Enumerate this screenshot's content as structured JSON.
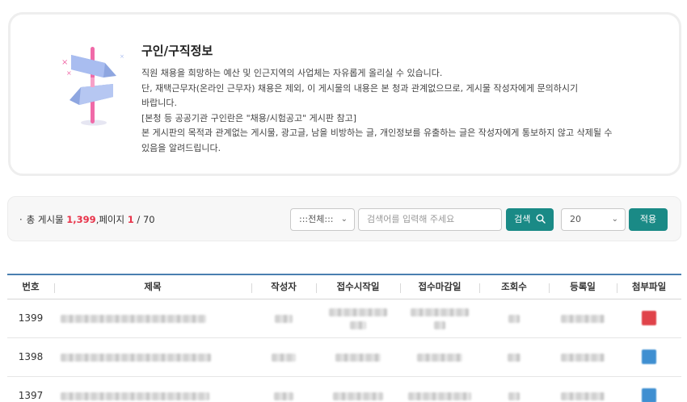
{
  "info": {
    "title": "구인/구직정보",
    "lines": [
      "직원 채용을 희망하는 예산 및 인근지역의 사업체는 자유롭게 올리실 수 있습니다.",
      "단, 재택근무자(온라인 근무자) 채용은 제외, 이 게시물의 내용은 본 청과 관계없으므로, 게시물 작성자에게 문의하시기",
      "바랍니다.",
      "[본청 등 공공기관 구인란은 \"채용/시험공고\" 게시판 참고]",
      "본 게시판의 목적과 관계없는 게시물, 광고글, 남을 비방하는 글, 개인정보를 유출하는 글은 작성자에게 통보하지 않고 삭제될 수",
      "있음을 알려드립니다."
    ]
  },
  "summary": {
    "bullet": "·",
    "total_label": "총 게시물",
    "total_value": "1,399",
    "separator": ",",
    "page_label": "페이지",
    "current_page": "1",
    "page_total": "/ 70"
  },
  "search": {
    "field_select": ":::전체:::",
    "input_placeholder": "검색어를 입력해 주세요",
    "search_button": "검색",
    "page_size": "20",
    "apply_button": "적용"
  },
  "table": {
    "headers": [
      "번호",
      "제목",
      "작성자",
      "접수시작일",
      "접수마감일",
      "조회수",
      "등록일",
      "첨부파일"
    ],
    "rows": [
      {
        "number": "1399",
        "file_color": "#e0434a"
      },
      {
        "number": "1398",
        "file_color": "#3f8fd1"
      },
      {
        "number": "1397",
        "file_color": "#3f8fd1"
      }
    ]
  },
  "colors": {
    "accent": "#1a8a86",
    "highlight": "#e8334a",
    "table_top_border": "#4a7fb0"
  }
}
